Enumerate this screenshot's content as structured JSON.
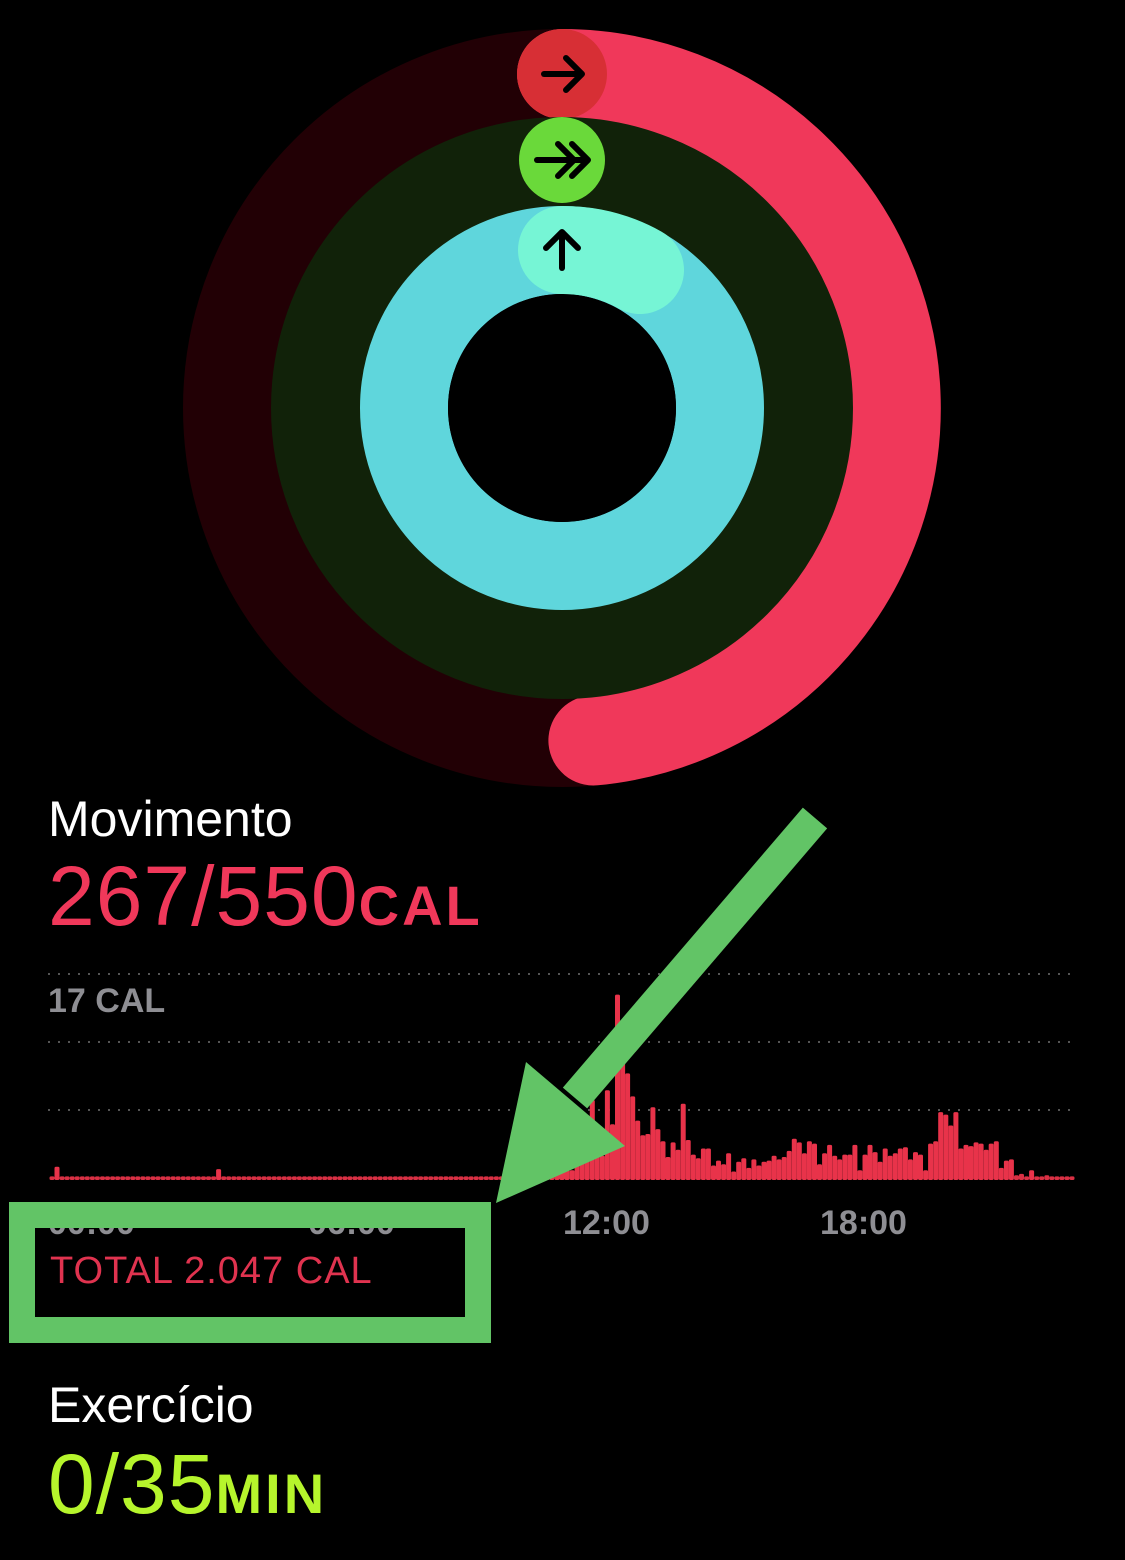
{
  "colors": {
    "move": "#f0385a",
    "exercise": "#b6f52c",
    "stand": "#62e3e0",
    "label_gray": "#8e8e93",
    "annotation_green": "#62c466"
  },
  "rings": {
    "move_progress": 0.485,
    "exercise_progress": 0.0,
    "stand_progress": 1.17,
    "icons": [
      "arrow-right-icon",
      "double-arrow-right-icon",
      "arrow-up-icon"
    ]
  },
  "move": {
    "title": "Movimento",
    "value": "267/550",
    "unit": "CAL"
  },
  "move_chart": {
    "max_label": "17 CAL",
    "x_ticks": [
      "00:00",
      "06:00",
      "12:00",
      "18:00"
    ],
    "total": "TOTAL 2.047 CAL"
  },
  "chart_data": {
    "type": "bar",
    "title": "",
    "xlabel": "",
    "ylabel": "",
    "ylim": [
      0,
      17
    ],
    "x_ticks": [
      "00:00",
      "06:00",
      "12:00",
      "18:00"
    ],
    "values": [
      0.3,
      1.1,
      0.3,
      0.3,
      0.3,
      0.3,
      0.3,
      0.3,
      0.3,
      0.3,
      0.3,
      0.3,
      0.3,
      0.3,
      0.3,
      0.3,
      0.3,
      0.3,
      0.3,
      0.3,
      0.3,
      0.3,
      0.3,
      0.3,
      0.3,
      0.3,
      0.3,
      0.3,
      0.3,
      0.3,
      0.3,
      0.3,
      0.3,
      0.9,
      0.3,
      0.3,
      0.3,
      0.3,
      0.3,
      0.3,
      0.3,
      0.3,
      0.3,
      0.3,
      0.3,
      0.3,
      0.3,
      0.3,
      0.3,
      0.3,
      0.3,
      0.3,
      0.3,
      0.3,
      0.3,
      0.3,
      0.3,
      0.3,
      0.3,
      0.3,
      0.3,
      0.3,
      0.3,
      0.3,
      0.3,
      0.3,
      0.3,
      0.3,
      0.3,
      0.3,
      0.3,
      0.3,
      0.3,
      0.3,
      0.3,
      0.3,
      0.3,
      0.3,
      0.3,
      0.3,
      0.3,
      0.3,
      0.3,
      0.3,
      0.3,
      0.3,
      0.3,
      0.3,
      0.3,
      0.3,
      0.3,
      0.3,
      3.0,
      4.0,
      3.6,
      2.6,
      1.2,
      2.4,
      3.4,
      1.6,
      0.7,
      1.8,
      1.4,
      0.8,
      2.6,
      3.2,
      2.8,
      6.6,
      3.5,
      2.0,
      7.4,
      4.6,
      15.3,
      13.2,
      8.8,
      6.9,
      4.9,
      3.7,
      3.8,
      6.0,
      4.2,
      3.2,
      1.9,
      3.1,
      2.5,
      6.3,
      3.3,
      2.1,
      1.8,
      2.6,
      2.6,
      1.2,
      1.6,
      1.3,
      2.2,
      0.7,
      1.5,
      1.8,
      1.0,
      1.7,
      1.2,
      1.5,
      1.6,
      2.0,
      1.7,
      1.9,
      2.4,
      3.4,
      3.1,
      2.2,
      3.2,
      3.0,
      1.3,
      2.2,
      2.9,
      2.0,
      1.7,
      2.1,
      2.1,
      2.9,
      0.8,
      2.1,
      2.9,
      2.3,
      1.5,
      2.6,
      2.0,
      2.2,
      2.6,
      2.7,
      1.7,
      2.3,
      2.1,
      0.8,
      3.0,
      3.2,
      5.6,
      5.4,
      4.5,
      5.6,
      2.6,
      2.9,
      2.8,
      3.1,
      3.0,
      2.5,
      3.0,
      3.2,
      1.0,
      1.6,
      1.7,
      0.4,
      0.5,
      0.3,
      0.8,
      0.3,
      0.3,
      0.4,
      0.3,
      0.3,
      0.3,
      0.3,
      0.3
    ]
  },
  "exercise": {
    "title": "Exercício",
    "value": "0/35",
    "unit": "MIN"
  }
}
